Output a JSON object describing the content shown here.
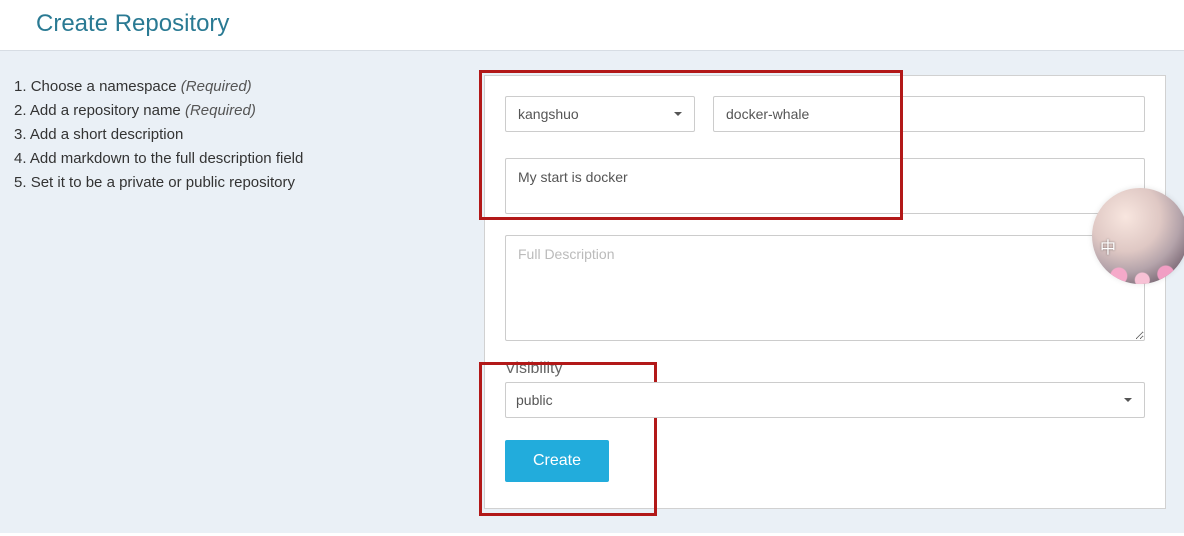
{
  "page": {
    "title": "Create Repository"
  },
  "instructions": {
    "items": [
      {
        "text": "Choose a namespace",
        "required": true
      },
      {
        "text": "Add a repository name",
        "required": true
      },
      {
        "text": "Add a short description",
        "required": false
      },
      {
        "text": "Add markdown to the full description field",
        "required": false
      },
      {
        "text": "Set it to be a private or public repository",
        "required": false
      }
    ],
    "required_label": "(Required)"
  },
  "form": {
    "namespace": {
      "value": "kangshuo"
    },
    "repo_name": {
      "value": "docker-whale"
    },
    "short_description": {
      "value": "My start is docker"
    },
    "full_description": {
      "value": "",
      "placeholder": "Full Description"
    },
    "visibility": {
      "label": "Visibility",
      "value": "public"
    },
    "submit_label": "Create"
  },
  "avatar": {
    "glyph": "中"
  }
}
